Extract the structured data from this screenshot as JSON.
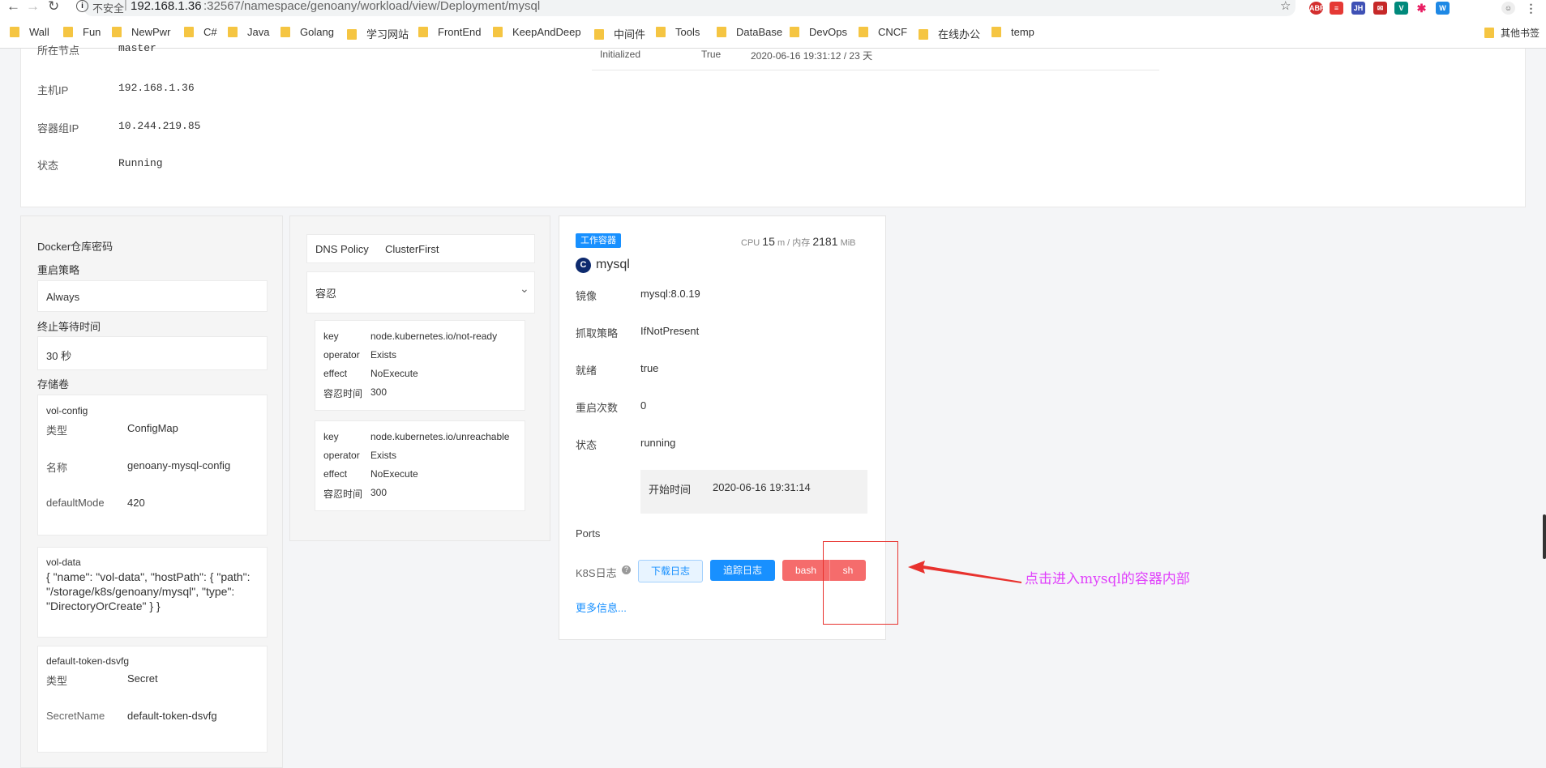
{
  "browser": {
    "insecure_label": "不安全",
    "url_host": "192.168.1.36",
    "url_rest": ":32567/namespace/genoany/workload/view/Deployment/mysql",
    "extensions": [
      "ABP",
      "JH",
      "1"
    ],
    "bookmarks": [
      "Wall",
      "Fun",
      "NewPwr",
      "C#",
      "Java",
      "Golang",
      "学习网站",
      "FrontEnd",
      "KeepAndDeep",
      "中间件",
      "Tools",
      "DataBase",
      "DevOps",
      "CNCF",
      "在线办公",
      "temp"
    ],
    "other_bookmarks": "其他书签"
  },
  "pod_info": {
    "node_label": "所在节点",
    "node_value": "master",
    "host_ip_label": "主机IP",
    "host_ip_value": "192.168.1.36",
    "pod_ip_label": "容器组IP",
    "pod_ip_value": "10.244.219.85",
    "status_label": "状态",
    "status_value": "Running"
  },
  "conditions_row": {
    "type": "Initialized",
    "status": "True",
    "time": "2020-06-16 19:31:12 / 23 天"
  },
  "left_panel": {
    "docker_secret_label": "Docker仓库密码",
    "restart_policy_label": "重启策略",
    "restart_policy_value": "Always",
    "termination_label": "终止等待时间",
    "termination_value": "30 秒",
    "volumes_label": "存储卷",
    "volumes": {
      "config": {
        "name": "vol-config",
        "type_label": "类型",
        "type_value": "ConfigMap",
        "name_label": "名称",
        "name_value": "genoany-mysql-config",
        "mode_label": "defaultMode",
        "mode_value": "420"
      },
      "data": {
        "name": "vol-data",
        "json": "{ \"name\": \"vol-data\", \"hostPath\": { \"path\": \"/storage/k8s/genoany/mysql\", \"type\": \"DirectoryOrCreate\" } }"
      },
      "token": {
        "name": "default-token-dsvfg",
        "type_label": "类型",
        "type_value": "Secret",
        "secret_label": "SecretName",
        "secret_value": "default-token-dsvfg"
      }
    }
  },
  "middle_panel": {
    "dns_policy_label": "DNS Policy",
    "dns_policy_value": "ClusterFirst",
    "tolerations_label": "容忍",
    "tolerations": [
      {
        "key_label": "key",
        "key": "node.kubernetes.io/not-ready",
        "op_label": "operator",
        "op": "Exists",
        "effect_label": "effect",
        "effect": "NoExecute",
        "sec_label": "容忍时间",
        "sec": "300"
      },
      {
        "key_label": "key",
        "key": "node.kubernetes.io/unreachable",
        "op_label": "operator",
        "op": "Exists",
        "effect_label": "effect",
        "effect": "NoExecute",
        "sec_label": "容忍时间",
        "sec": "300"
      }
    ]
  },
  "container": {
    "tag": "工作容器",
    "cpu_label": "CPU",
    "cpu_value": "15",
    "cpu_unit": "m / 内存",
    "mem_value": "2181",
    "mem_unit": "MiB",
    "icon_letter": "C",
    "name": "mysql",
    "image_label": "镜像",
    "image_value": "mysql:8.0.19",
    "pull_label": "抓取策略",
    "pull_value": "IfNotPresent",
    "ready_label": "就绪",
    "ready_value": "true",
    "restarts_label": "重启次数",
    "restarts_value": "0",
    "state_label": "状态",
    "state_value": "running",
    "start_label": "开始时间",
    "start_value": "2020-06-16 19:31:14",
    "ports_label": "Ports",
    "logs_label": "K8S日志",
    "download_logs": "下载日志",
    "follow_logs": "追踪日志",
    "bash": "bash",
    "sh": "sh",
    "more_info": "更多信息..."
  },
  "annotation": {
    "text": "点击进入mysql的容器内部"
  },
  "colors": {
    "primary": "#1890ff",
    "danger": "#f56c6c",
    "annotation": "#e040fb",
    "arrow": "#e8322e"
  }
}
